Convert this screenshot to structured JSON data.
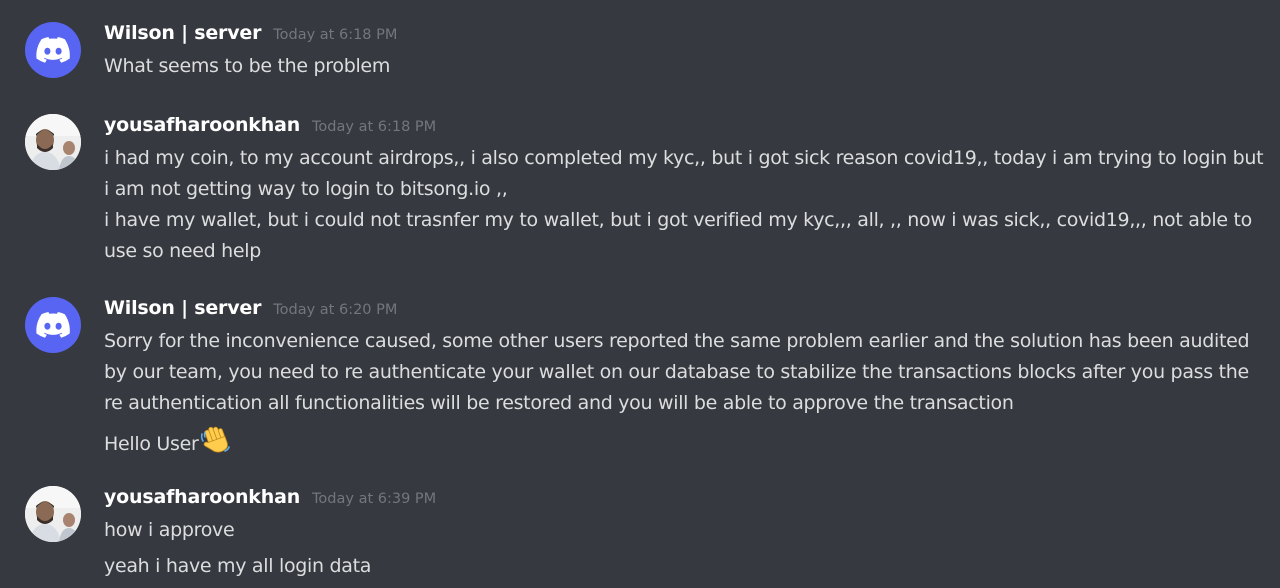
{
  "messages": [
    {
      "author": "Wilson | server",
      "time": "Today at 6:18 PM",
      "avatar_icon": "discord-logo-icon",
      "lines": [
        "What seems to be the problem"
      ]
    },
    {
      "author": "yousafharoonkhan",
      "time": "Today at 6:18 PM",
      "avatar_icon": "user-photo",
      "lines": [
        "i had my coin, to my account airdrops,, i also completed my kyc,, but i got sick reason covid19,, today i am trying to login but i am not getting way to login to bitsong.io ,,",
        "i have my wallet, but i could not trasnfer my to wallet, but i got verified my kyc,,, all, ,, now i was sick,, covid19,,, not able to use so need help"
      ]
    },
    {
      "author": "Wilson | server",
      "time": "Today at 6:20 PM",
      "avatar_icon": "discord-logo-icon",
      "lines": [
        "Sorry for the inconvenience caused, some other users reported the same problem earlier and the solution has been audited by our team, you need to re authenticate your wallet on our database to stabilize the transactions blocks after you pass the re authentication all functionalities will be restored and you will be able to approve the transaction",
        "Hello User"
      ],
      "emoji": "waving-hand-emoji"
    },
    {
      "author": "yousafharoonkhan",
      "time": "Today at 6:39 PM",
      "avatar_icon": "user-photo",
      "lines": [
        "how i approve",
        "yeah i have my all login data"
      ]
    }
  ],
  "colors": {
    "background": "#36393f",
    "username": "#ffffff",
    "message_text": "#dcddde",
    "timestamp": "#72767d",
    "discord_blurple": "#5865f2"
  }
}
